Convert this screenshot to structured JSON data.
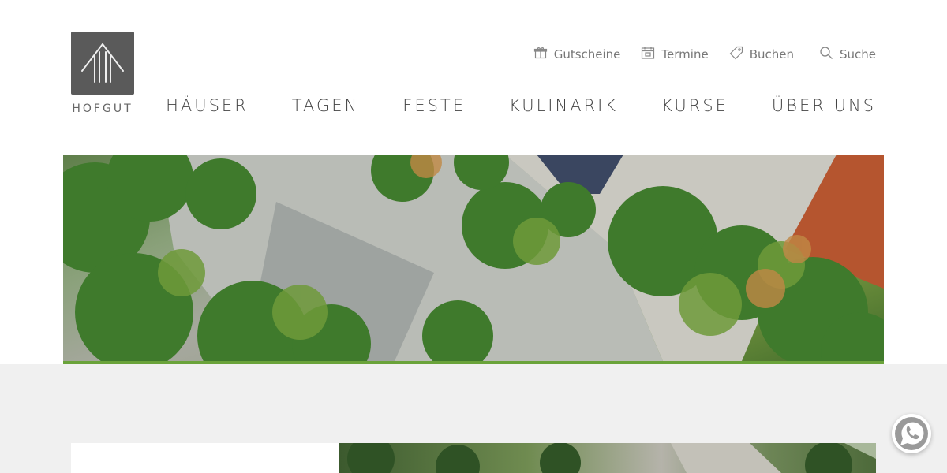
{
  "brand": {
    "name": "HOFGUT"
  },
  "utility_nav": [
    {
      "label": "Gutscheine",
      "icon": "gift-icon"
    },
    {
      "label": "Termine",
      "icon": "calendar-icon"
    },
    {
      "label": "Buchen",
      "icon": "tag-icon"
    },
    {
      "label": "Suche",
      "icon": "search-icon"
    }
  ],
  "main_nav": [
    {
      "label": "HÄUSER"
    },
    {
      "label": "TAGEN"
    },
    {
      "label": "FESTE"
    },
    {
      "label": "KULINARIK"
    },
    {
      "label": "KURSE"
    },
    {
      "label": "ÜBER UNS"
    }
  ],
  "colors": {
    "accent_green": "#6aa33a",
    "logo_bg": "#5a5a5a",
    "band_bg": "#f0f0f0",
    "text": "#555555"
  },
  "hero": {
    "image": "aerial-garden-photo"
  },
  "floating": {
    "icon": "whatsapp-icon"
  }
}
